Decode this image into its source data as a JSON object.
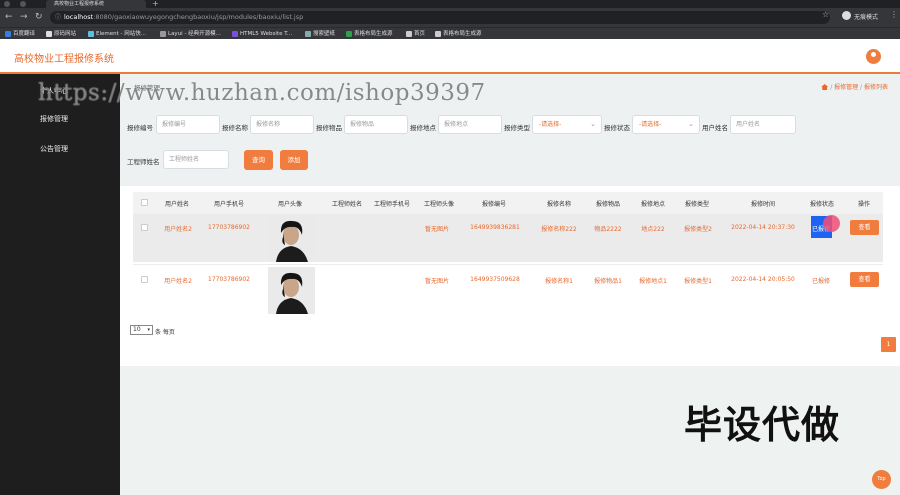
{
  "browser": {
    "tab_title": "高校物业工程报修系统",
    "new_tab": "+",
    "url_host": "localhost",
    "url_path": ":8080/gaoxiaowuyegongchengbaoxiu/jsp/modules/baoxiu/list.jsp",
    "profile_label": "无痕模式",
    "bookmarks": [
      "百度翻译",
      "原码网站",
      "Element - 网站快...",
      "Layui - 经典开源模...",
      "HTML5 Website T...",
      "搜索壁纸",
      "表格布局生成源",
      "首页",
      "表格布局生成源"
    ]
  },
  "app": {
    "title": "高校物业工程报修系统"
  },
  "sidebar": {
    "items": [
      {
        "label": "个人中心"
      },
      {
        "label": "报修管理"
      },
      {
        "label": "公告管理"
      }
    ]
  },
  "breadcrumb": {
    "left": "报修管理",
    "right_items": [
      "报修管理",
      "报修列表"
    ]
  },
  "search": {
    "fields": [
      {
        "label": "报修编号",
        "placeholder": "报修编号"
      },
      {
        "label": "报修名称",
        "placeholder": "报修名称"
      },
      {
        "label": "报修物品",
        "placeholder": "报修物品"
      },
      {
        "label": "报修地点",
        "placeholder": "报修地点"
      },
      {
        "label": "报修类型",
        "value": "-请选择-"
      },
      {
        "label": "报修状态",
        "value": "-请选择-"
      },
      {
        "label": "用户姓名",
        "placeholder": "用户姓名"
      },
      {
        "label": "工程师姓名",
        "placeholder": "工程师姓名"
      }
    ],
    "query_button": "查询",
    "add_button": "添加"
  },
  "table": {
    "headers": [
      "用户姓名",
      "用户手机号",
      "用户头像",
      "工程师姓名",
      "工程师手机号",
      "工程师头像",
      "报修编号",
      "报修名称",
      "报修物品",
      "报修地点",
      "报修类型",
      "报修时间",
      "报修状态",
      "操作"
    ],
    "rows": [
      {
        "user_name": "用户姓名2",
        "user_phone": "17703786902",
        "engineer_name": "",
        "engineer_phone": "",
        "engineer_avatar": "暂无图片",
        "repair_no": "1649939836281",
        "repair_name": "报修名称222",
        "repair_item": "物品2222",
        "repair_place": "地点222",
        "repair_type": "报修类型2",
        "repair_time": "2022-04-14 20:37:30",
        "status": "已报修",
        "action": "查看"
      },
      {
        "user_name": "用户姓名2",
        "user_phone": "17703786902",
        "engineer_name": "",
        "engineer_phone": "",
        "engineer_avatar": "暂无图片",
        "repair_no": "1649937509628",
        "repair_name": "报修名称1",
        "repair_item": "报修物品1",
        "repair_place": "报修地点1",
        "repair_type": "报修类型1",
        "repair_time": "2022-04-14 20:05:50",
        "status": "已报修",
        "action": "查看"
      }
    ]
  },
  "pagination": {
    "page_size": "10",
    "page_size_label": "条 每页",
    "current_page": "1"
  },
  "top_button": "Top",
  "watermark": "https://www.huzhan.com/ishop39397",
  "overlay_text": "毕设代做",
  "colors": {
    "accent": "#f07c3e",
    "sidebar_bg": "#1e1e1e",
    "content_bg": "#eef1f1"
  }
}
